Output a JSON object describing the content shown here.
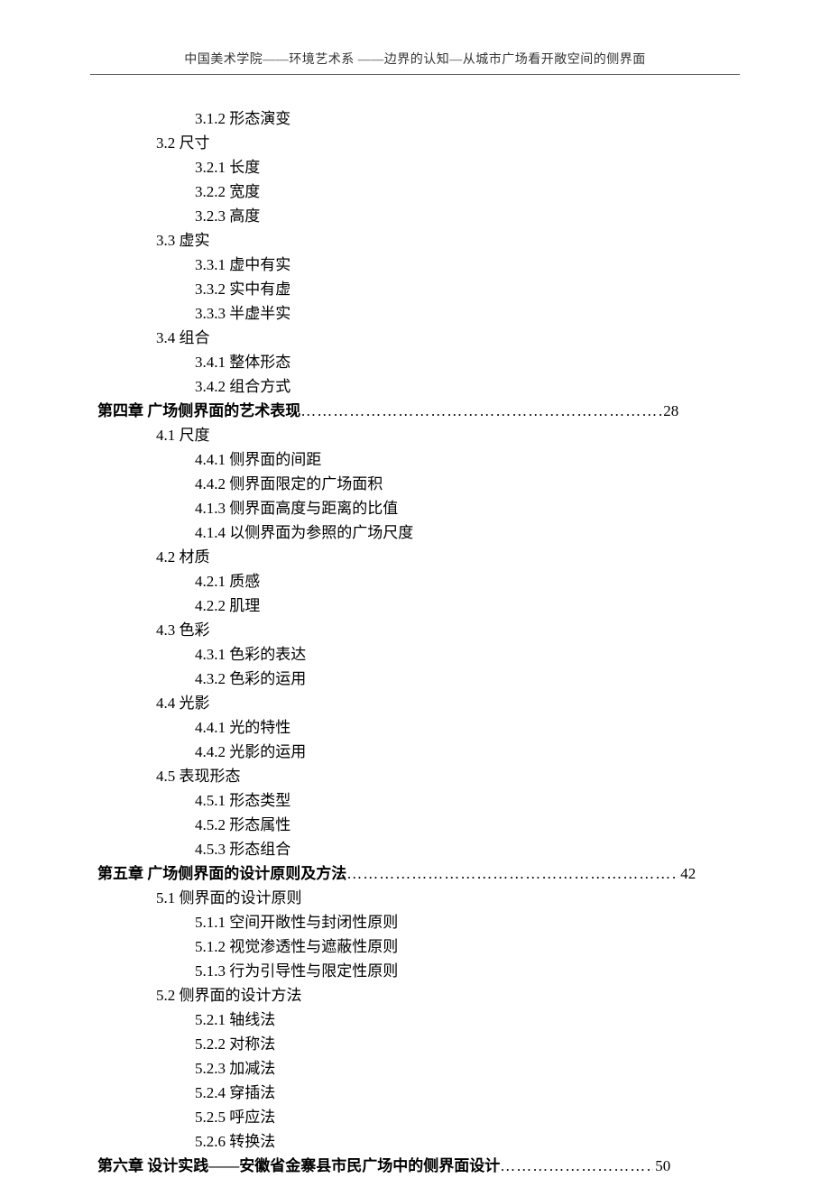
{
  "header": "中国美术学院——环境艺术系  ——边界的认知—从城市广场看开敞空间的侧界面",
  "toc": [
    {
      "indent": 2,
      "text": "3.1.2 形态演变"
    },
    {
      "indent": 1,
      "text": "3.2 尺寸"
    },
    {
      "indent": 2,
      "text": "3.2.1 长度"
    },
    {
      "indent": 2,
      "text": "3.2.2 宽度"
    },
    {
      "indent": 2,
      "text": "3.2.3 高度"
    },
    {
      "indent": 1,
      "text": "3.3 虚实"
    },
    {
      "indent": 2,
      "text": "3.3.1 虚中有实"
    },
    {
      "indent": 2,
      "text": "3.3.2 实中有虚"
    },
    {
      "indent": 2,
      "text": "3.3.3 半虚半实"
    },
    {
      "indent": 1,
      "text": "3.4 组合"
    },
    {
      "indent": 2,
      "text": "3.4.1 整体形态"
    },
    {
      "indent": 2,
      "text": "3.4.2 组合方式"
    },
    {
      "indent": 0,
      "chapter": true,
      "text": "第四章  广场侧界面的艺术表现",
      "page": "28",
      "dotsWidth": 400
    },
    {
      "indent": 1,
      "text": "4.1 尺度"
    },
    {
      "indent": 2,
      "text": "4.4.1 侧界面的间距"
    },
    {
      "indent": 2,
      "text": "4.4.2 侧界面限定的广场面积"
    },
    {
      "indent": 2,
      "text": "4.1.3 侧界面高度与距离的比值"
    },
    {
      "indent": 2,
      "text": "4.1.4 以侧界面为参照的广场尺度"
    },
    {
      "indent": 1,
      "text": "4.2 材质"
    },
    {
      "indent": 2,
      "text": "4.2.1 质感"
    },
    {
      "indent": 2,
      "text": "4.2.2 肌理"
    },
    {
      "indent": 1,
      "text": "4.3 色彩"
    },
    {
      "indent": 2,
      "text": "4.3.1 色彩的表达"
    },
    {
      "indent": 2,
      "text": "4.3.2 色彩的运用"
    },
    {
      "indent": 1,
      "text": "4.4 光影"
    },
    {
      "indent": 2,
      "text": "4.4.1 光的特性"
    },
    {
      "indent": 2,
      "text": "4.4.2 光影的运用"
    },
    {
      "indent": 1,
      "text": "4.5 表现形态"
    },
    {
      "indent": 2,
      "text": "4.5.1 形态类型"
    },
    {
      "indent": 2,
      "text": "4.5.2 形态属性"
    },
    {
      "indent": 2,
      "text": "4.5.3 形态组合"
    },
    {
      "indent": 0,
      "chapter": true,
      "text": "第五章  广场侧界面的设计原则及方法",
      "page": "42",
      "dotsWidth": 368
    },
    {
      "indent": 1,
      "text": "5.1 侧界面的设计原则"
    },
    {
      "indent": 2,
      "text": "5.1.1 空间开敞性与封闭性原则"
    },
    {
      "indent": 2,
      "text": "5.1.2 视觉渗透性与遮蔽性原则"
    },
    {
      "indent": 2,
      "text": "5.1.3 行为引导性与限定性原则"
    },
    {
      "indent": 1,
      "text": "5.2 侧界面的设计方法"
    },
    {
      "indent": 2,
      "text": "5.2.1 轴线法"
    },
    {
      "indent": 2,
      "text": "5.2.2 对称法"
    },
    {
      "indent": 2,
      "text": "5.2.3 加减法"
    },
    {
      "indent": 2,
      "text": "5.2.4 穿插法"
    },
    {
      "indent": 2,
      "text": "5.2.5 呼应法"
    },
    {
      "indent": 2,
      "text": "5.2.6 转换法"
    },
    {
      "indent": 0,
      "chapter": true,
      "text": "第六章  设计实践——安徽省金寨县市民广场中的侧界面设计",
      "page": "50",
      "dotsWidth": 170
    }
  ]
}
